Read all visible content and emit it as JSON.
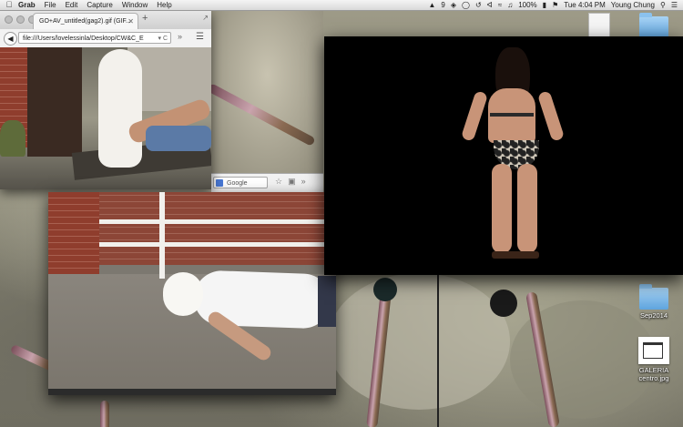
{
  "menubar": {
    "apple_icon": "apple-icon",
    "app_name": "Grab",
    "menus": [
      "File",
      "Edit",
      "Capture",
      "Window",
      "Help"
    ],
    "badge_count": "9",
    "battery": "100%",
    "clock": "Tue 4:04 PM",
    "user": "Young Chung"
  },
  "browser": {
    "tab_title": "GO+AV_untitled(gag2).gif (GIF...",
    "url": "file:///Users/lovelessinla/Desktop/CW&C_E",
    "search_placeholder": "Google"
  },
  "desktop": {
    "icons": [
      {
        "label": "Sep2014",
        "icon": "folder-icon"
      },
      {
        "label": "GALERIA\ncentro.jpg",
        "icon": "image-file-icon"
      }
    ]
  },
  "colors": {
    "menubar_bg": "#e6e6e6",
    "folder_blue": "#6fb0e6",
    "video_bg": "#000000"
  }
}
